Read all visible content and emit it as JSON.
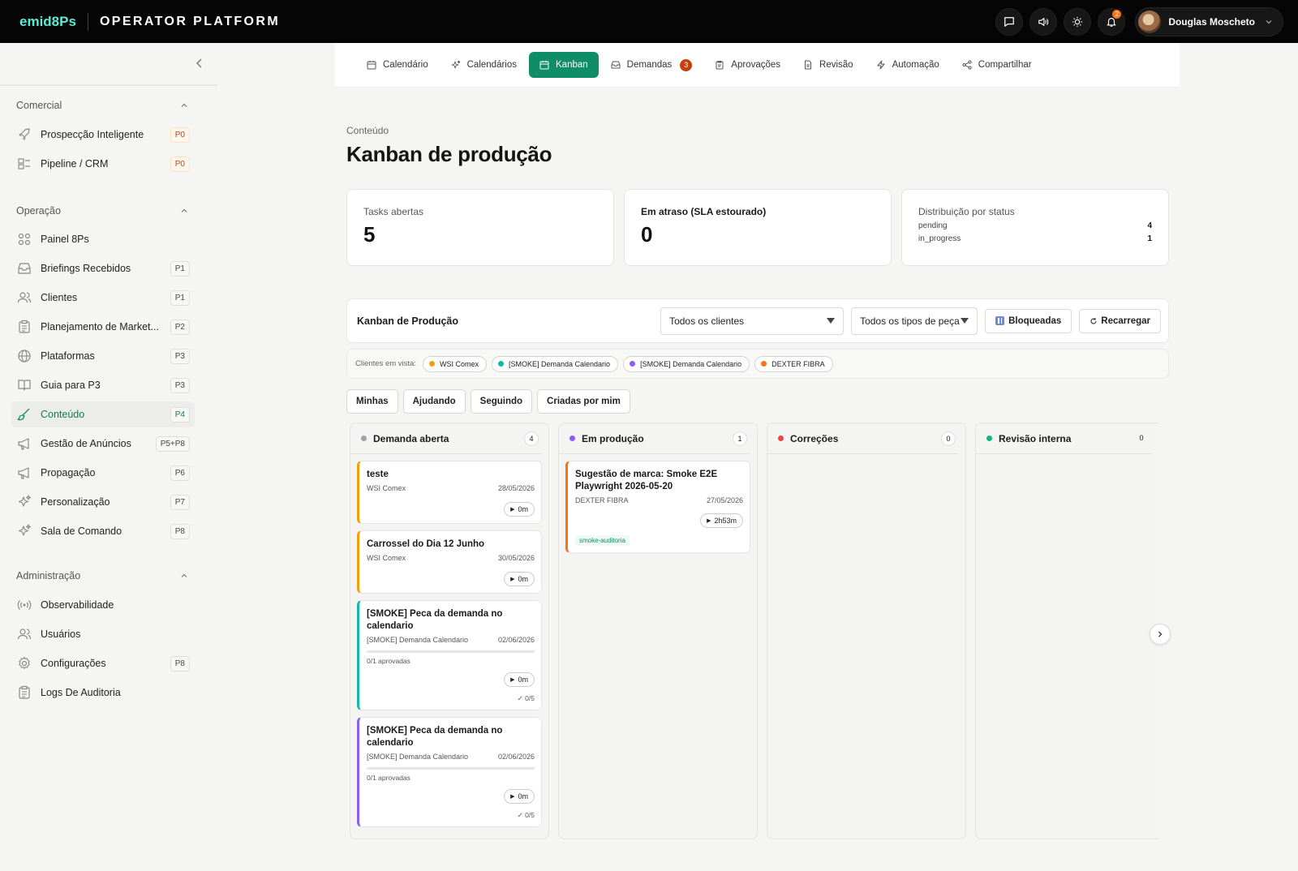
{
  "app": {
    "logo_text": "emid8Ps",
    "platform_title": "OPERATOR PLATFORM",
    "notification_count": "2",
    "user_name": "Douglas Moscheto"
  },
  "sidebar": {
    "sections": [
      {
        "title": "Comercial"
      },
      {
        "title": "Operação"
      },
      {
        "title": "Administração"
      }
    ],
    "items": [
      {
        "label": "Prospecção Inteligente",
        "badge": "P0",
        "icon": "rocket-icon"
      },
      {
        "label": "Pipeline / CRM",
        "badge": "P0",
        "icon": "pipeline-icon"
      },
      {
        "label": "Painel 8Ps",
        "badge": "",
        "icon": "grid-icon"
      },
      {
        "label": "Briefings Recebidos",
        "badge": "P1",
        "icon": "inbox-icon"
      },
      {
        "label": "Clientes",
        "badge": "P1",
        "icon": "users-icon"
      },
      {
        "label": "Planejamento de Market...",
        "badge": "P2",
        "icon": "clipboard-icon"
      },
      {
        "label": "Plataformas",
        "badge": "P3",
        "icon": "globe-icon"
      },
      {
        "label": "Guia para P3",
        "badge": "P3",
        "icon": "book-icon"
      },
      {
        "label": "Conteúdo",
        "badge": "P4",
        "icon": "brush-icon"
      },
      {
        "label": "Gestão de Anúncios",
        "badge": "P5+P8",
        "icon": "megaphone-icon"
      },
      {
        "label": "Propagação",
        "badge": "P6",
        "icon": "megaphone-icon"
      },
      {
        "label": "Personalização",
        "badge": "P7",
        "icon": "sparkles-icon"
      },
      {
        "label": "Sala de Comando",
        "badge": "P8",
        "icon": "sparkles-icon"
      },
      {
        "label": "Observabilidade",
        "badge": "",
        "icon": "radio-icon"
      },
      {
        "label": "Usuários",
        "badge": "",
        "icon": "users-icon"
      },
      {
        "label": "Configurações",
        "badge": "P8",
        "icon": "gear-icon"
      },
      {
        "label": "Logs De Auditoria",
        "badge": "",
        "icon": "clipboard-icon"
      }
    ]
  },
  "tabs": [
    {
      "label": "Calendário",
      "icon": "calendar-icon"
    },
    {
      "label": "Calendários",
      "icon": "sparkle-icon"
    },
    {
      "label": "Kanban",
      "icon": "kanban-icon"
    },
    {
      "label": "Demandas",
      "icon": "inbox-icon",
      "count": "3"
    },
    {
      "label": "Aprovações",
      "icon": "clipboard-icon"
    },
    {
      "label": "Revisão",
      "icon": "file-icon"
    },
    {
      "label": "Automação",
      "icon": "bolt-icon"
    },
    {
      "label": "Compartilhar",
      "icon": "share-icon"
    }
  ],
  "page": {
    "breadcrumb": "Conteúdo",
    "title": "Kanban de produção"
  },
  "stats": {
    "open_tasks": {
      "label": "Tasks abertas",
      "value": "5"
    },
    "overdue": {
      "label": "Em atraso (SLA estourado)",
      "value": "0"
    },
    "distribution": {
      "label": "Distribuição por status",
      "rows": [
        {
          "status": "pending",
          "count": "4"
        },
        {
          "status": "in_progress",
          "count": "1"
        }
      ]
    }
  },
  "kanban": {
    "title": "Kanban de Produção",
    "client_select": "Todos os clientes",
    "type_select": "Todos os tipos de peça",
    "blocked_button": "Bloqueadas",
    "reload_button": "Recarregar",
    "clients_label": "Clientes em vista:",
    "clients": [
      {
        "name": "WSI Comex",
        "color": "#f59e0b"
      },
      {
        "name": "[SMOKE] Demanda Calendario",
        "color": "#14b8a6"
      },
      {
        "name": "[SMOKE] Demanda Calendario",
        "color": "#8b5cf6"
      },
      {
        "name": "DEXTER FIBRA",
        "color": "#f97316"
      }
    ],
    "filters": [
      "Minhas",
      "Ajudando",
      "Seguindo",
      "Criadas por mim"
    ],
    "columns": [
      {
        "title": "Demanda aberta",
        "count": "4",
        "color": "#9ca3af"
      },
      {
        "title": "Em produção",
        "count": "1",
        "color": "#8b5cf6"
      },
      {
        "title": "Correções",
        "count": "0",
        "color": "#ef4444"
      },
      {
        "title": "Revisão interna",
        "count": "0",
        "color": "#10b981"
      }
    ],
    "cards_col1": [
      {
        "title": "teste",
        "client": "WSI Comex",
        "date": "28/05/2026",
        "timer": "0m",
        "color": "#f59e0b"
      },
      {
        "title": "Carrossel do Dia 12 Junho",
        "client": "WSI Comex",
        "date": "30/05/2026",
        "timer": "0m",
        "color": "#f59e0b"
      },
      {
        "title": "[SMOKE] Peca da demanda no calendario",
        "client": "[SMOKE] Demanda Calendario",
        "date": "02/06/2026",
        "approved": "0/1 aprovadas",
        "timer": "0m",
        "checks": "0/5",
        "color": "#14b8a6"
      },
      {
        "title": "[SMOKE] Peca da demanda no calendario",
        "client": "[SMOKE] Demanda Calendario",
        "date": "02/06/2026",
        "approved": "0/1 aprovadas",
        "timer": "0m",
        "checks": "0/5",
        "color": "#8b5cf6"
      }
    ],
    "cards_col2": [
      {
        "title": "Sugestão de marca: Smoke E2E Playwright 2026-05-20",
        "client": "DEXTER FIBRA",
        "date": "27/05/2026",
        "timer": "2h53m",
        "tag": "smoke-auditoria",
        "color": "#f97316"
      }
    ]
  },
  "colors": {
    "accent": "#0f8d64",
    "topbar": "#050505"
  }
}
